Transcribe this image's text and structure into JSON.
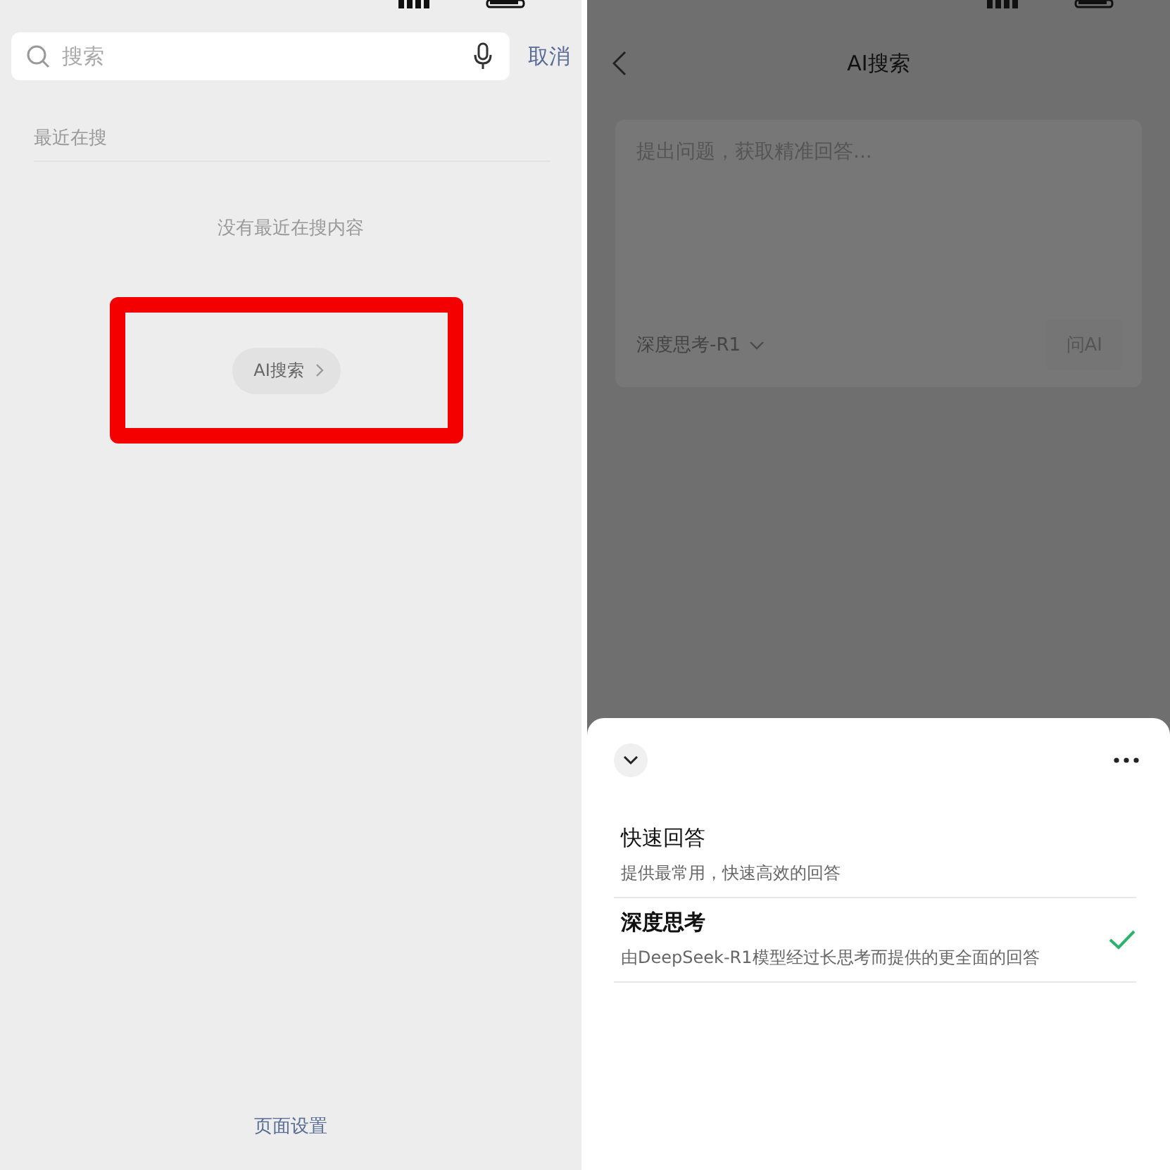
{
  "search_screen": {
    "search_field": {
      "placeholder": "搜索"
    },
    "cancel": "取消",
    "recent_heading": "最近在搜",
    "empty_message": "没有最近在搜内容",
    "ai_search_link": "AI搜索",
    "ai_search_highlighted": true,
    "page_settings": "页面设置"
  },
  "ai_screen": {
    "title": "AI搜索",
    "question_field": {
      "placeholder": "提出问题，获取精准回答..."
    },
    "model_selector": "深度思考-R1",
    "ask_button": "问AI",
    "ask_disabled": true,
    "mode_sheet": {
      "options": [
        {
          "title": "快速回答",
          "description": "提供最常用，快速高效的回答",
          "selected": false
        },
        {
          "title": "深度思考",
          "description": "由DeepSeek-R1模型经过长思考而提供的更全面的回答",
          "selected": true
        }
      ]
    }
  }
}
